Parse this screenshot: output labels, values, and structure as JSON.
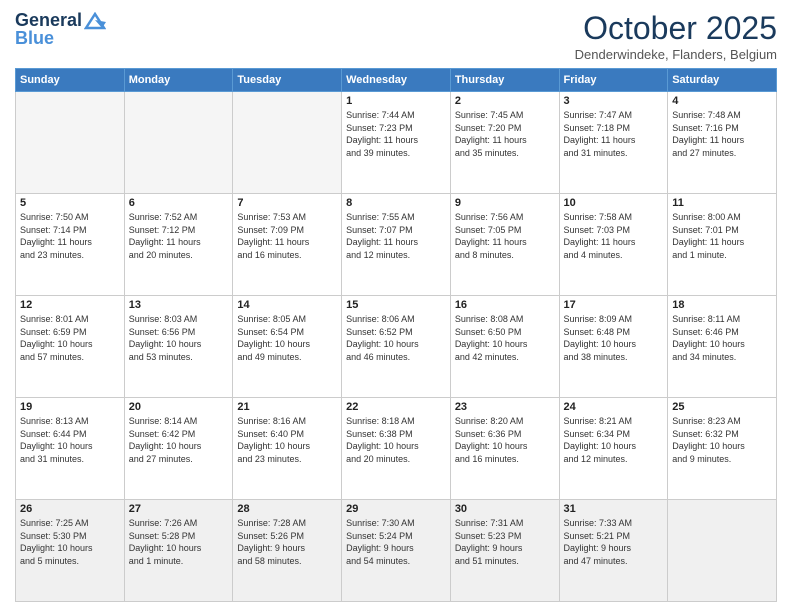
{
  "header": {
    "logo_line1": "General",
    "logo_line2": "Blue",
    "month_title": "October 2025",
    "location": "Denderwindeke, Flanders, Belgium"
  },
  "weekdays": [
    "Sunday",
    "Monday",
    "Tuesday",
    "Wednesday",
    "Thursday",
    "Friday",
    "Saturday"
  ],
  "weeks": [
    [
      {
        "day": "",
        "info": ""
      },
      {
        "day": "",
        "info": ""
      },
      {
        "day": "",
        "info": ""
      },
      {
        "day": "1",
        "info": "Sunrise: 7:44 AM\nSunset: 7:23 PM\nDaylight: 11 hours\nand 39 minutes."
      },
      {
        "day": "2",
        "info": "Sunrise: 7:45 AM\nSunset: 7:20 PM\nDaylight: 11 hours\nand 35 minutes."
      },
      {
        "day": "3",
        "info": "Sunrise: 7:47 AM\nSunset: 7:18 PM\nDaylight: 11 hours\nand 31 minutes."
      },
      {
        "day": "4",
        "info": "Sunrise: 7:48 AM\nSunset: 7:16 PM\nDaylight: 11 hours\nand 27 minutes."
      }
    ],
    [
      {
        "day": "5",
        "info": "Sunrise: 7:50 AM\nSunset: 7:14 PM\nDaylight: 11 hours\nand 23 minutes."
      },
      {
        "day": "6",
        "info": "Sunrise: 7:52 AM\nSunset: 7:12 PM\nDaylight: 11 hours\nand 20 minutes."
      },
      {
        "day": "7",
        "info": "Sunrise: 7:53 AM\nSunset: 7:09 PM\nDaylight: 11 hours\nand 16 minutes."
      },
      {
        "day": "8",
        "info": "Sunrise: 7:55 AM\nSunset: 7:07 PM\nDaylight: 11 hours\nand 12 minutes."
      },
      {
        "day": "9",
        "info": "Sunrise: 7:56 AM\nSunset: 7:05 PM\nDaylight: 11 hours\nand 8 minutes."
      },
      {
        "day": "10",
        "info": "Sunrise: 7:58 AM\nSunset: 7:03 PM\nDaylight: 11 hours\nand 4 minutes."
      },
      {
        "day": "11",
        "info": "Sunrise: 8:00 AM\nSunset: 7:01 PM\nDaylight: 11 hours\nand 1 minute."
      }
    ],
    [
      {
        "day": "12",
        "info": "Sunrise: 8:01 AM\nSunset: 6:59 PM\nDaylight: 10 hours\nand 57 minutes."
      },
      {
        "day": "13",
        "info": "Sunrise: 8:03 AM\nSunset: 6:56 PM\nDaylight: 10 hours\nand 53 minutes."
      },
      {
        "day": "14",
        "info": "Sunrise: 8:05 AM\nSunset: 6:54 PM\nDaylight: 10 hours\nand 49 minutes."
      },
      {
        "day": "15",
        "info": "Sunrise: 8:06 AM\nSunset: 6:52 PM\nDaylight: 10 hours\nand 46 minutes."
      },
      {
        "day": "16",
        "info": "Sunrise: 8:08 AM\nSunset: 6:50 PM\nDaylight: 10 hours\nand 42 minutes."
      },
      {
        "day": "17",
        "info": "Sunrise: 8:09 AM\nSunset: 6:48 PM\nDaylight: 10 hours\nand 38 minutes."
      },
      {
        "day": "18",
        "info": "Sunrise: 8:11 AM\nSunset: 6:46 PM\nDaylight: 10 hours\nand 34 minutes."
      }
    ],
    [
      {
        "day": "19",
        "info": "Sunrise: 8:13 AM\nSunset: 6:44 PM\nDaylight: 10 hours\nand 31 minutes."
      },
      {
        "day": "20",
        "info": "Sunrise: 8:14 AM\nSunset: 6:42 PM\nDaylight: 10 hours\nand 27 minutes."
      },
      {
        "day": "21",
        "info": "Sunrise: 8:16 AM\nSunset: 6:40 PM\nDaylight: 10 hours\nand 23 minutes."
      },
      {
        "day": "22",
        "info": "Sunrise: 8:18 AM\nSunset: 6:38 PM\nDaylight: 10 hours\nand 20 minutes."
      },
      {
        "day": "23",
        "info": "Sunrise: 8:20 AM\nSunset: 6:36 PM\nDaylight: 10 hours\nand 16 minutes."
      },
      {
        "day": "24",
        "info": "Sunrise: 8:21 AM\nSunset: 6:34 PM\nDaylight: 10 hours\nand 12 minutes."
      },
      {
        "day": "25",
        "info": "Sunrise: 8:23 AM\nSunset: 6:32 PM\nDaylight: 10 hours\nand 9 minutes."
      }
    ],
    [
      {
        "day": "26",
        "info": "Sunrise: 7:25 AM\nSunset: 5:30 PM\nDaylight: 10 hours\nand 5 minutes."
      },
      {
        "day": "27",
        "info": "Sunrise: 7:26 AM\nSunset: 5:28 PM\nDaylight: 10 hours\nand 1 minute."
      },
      {
        "day": "28",
        "info": "Sunrise: 7:28 AM\nSunset: 5:26 PM\nDaylight: 9 hours\nand 58 minutes."
      },
      {
        "day": "29",
        "info": "Sunrise: 7:30 AM\nSunset: 5:24 PM\nDaylight: 9 hours\nand 54 minutes."
      },
      {
        "day": "30",
        "info": "Sunrise: 7:31 AM\nSunset: 5:23 PM\nDaylight: 9 hours\nand 51 minutes."
      },
      {
        "day": "31",
        "info": "Sunrise: 7:33 AM\nSunset: 5:21 PM\nDaylight: 9 hours\nand 47 minutes."
      },
      {
        "day": "",
        "info": ""
      }
    ]
  ]
}
